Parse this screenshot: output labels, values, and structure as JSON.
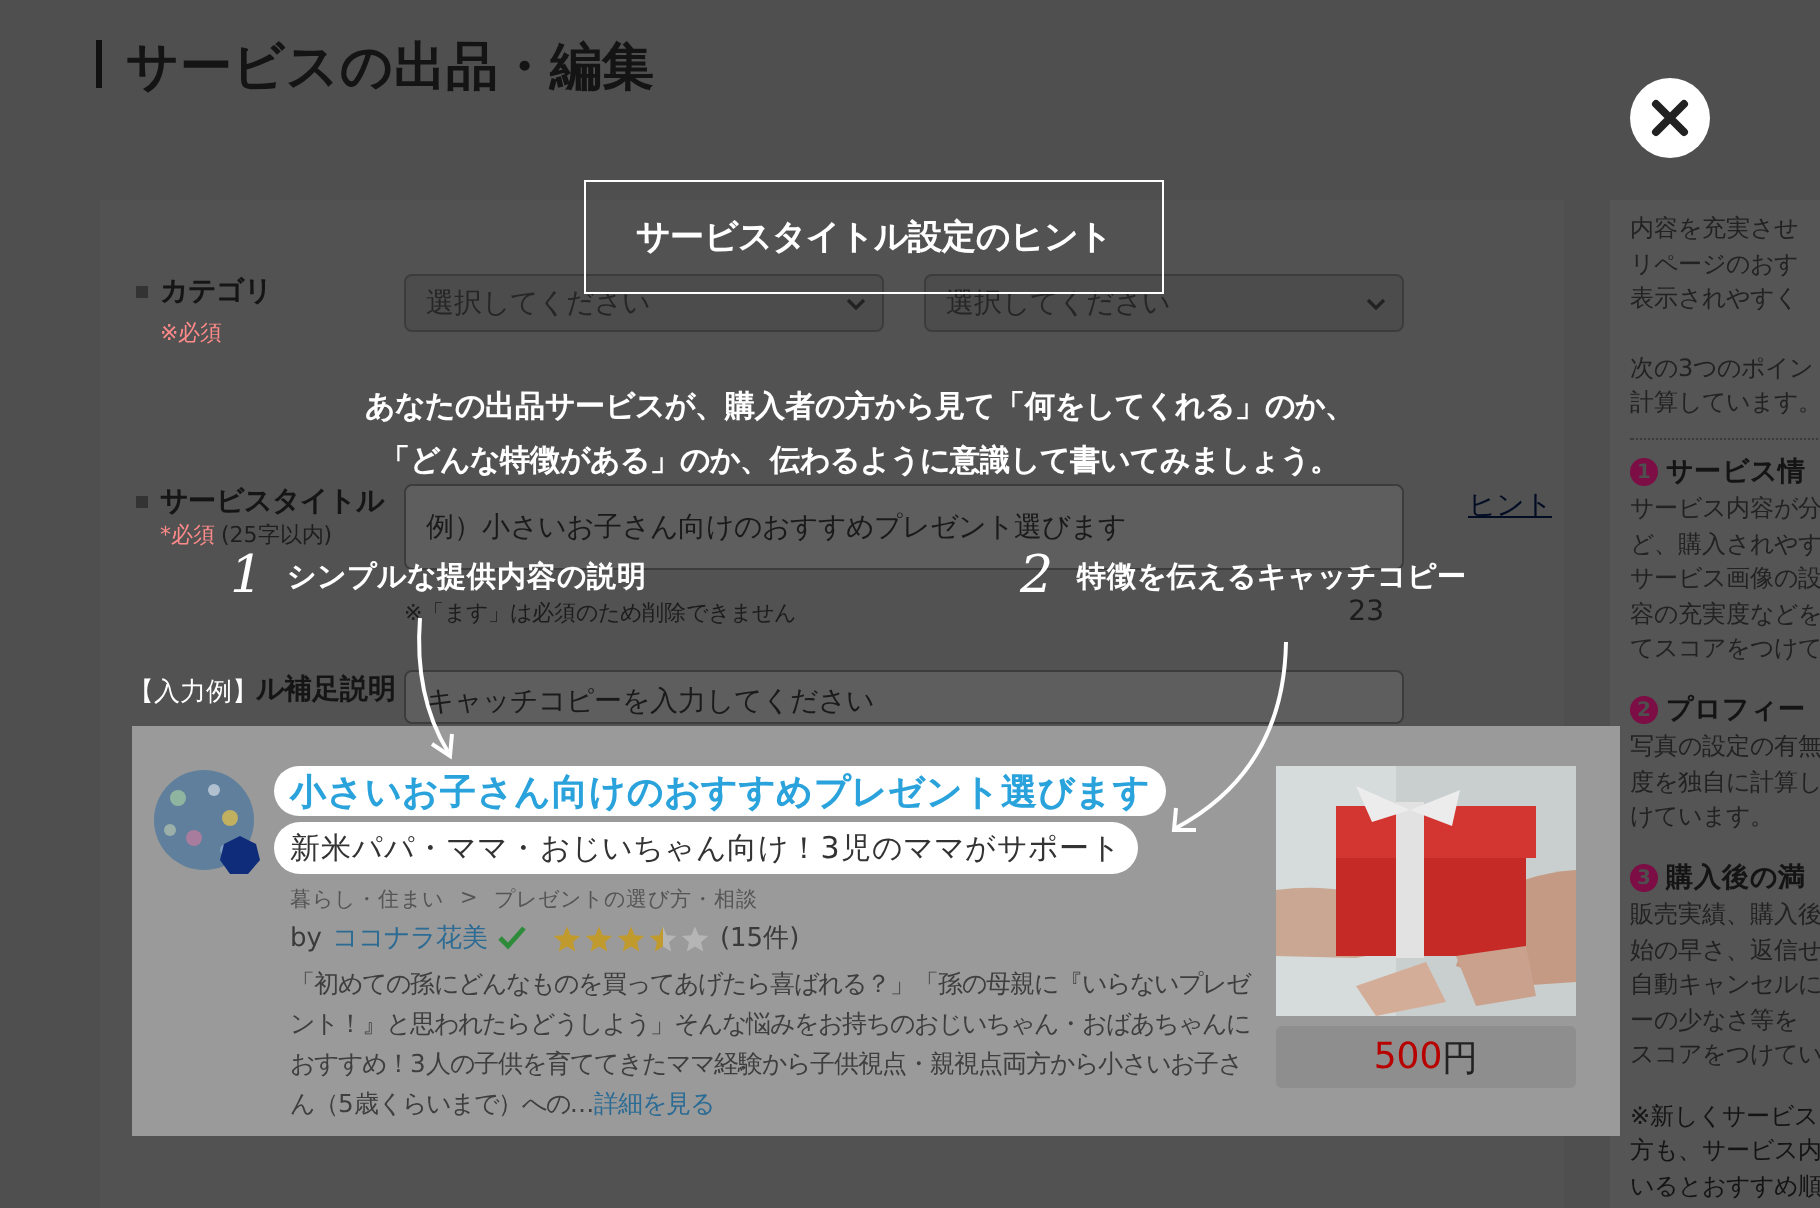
{
  "header": {
    "title": "サービスの出品・編集"
  },
  "form": {
    "rows": [
      {
        "kind": "select",
        "label": "カテゴリ",
        "required": "※必須",
        "selects": [
          "選択してください",
          "選択してください"
        ]
      },
      {
        "kind": "title",
        "label": "サービスタイトル",
        "required": "*必須",
        "limit": "(25字以内)",
        "placeholder": "例）小さいお子さん向けのおすすめプレゼント選びます",
        "hint_link": "ヒント",
        "note": "※「ます」は必須のため削除できません",
        "count": "23"
      },
      {
        "kind": "catch",
        "label": "ル補足説明",
        "placeholder": "キャッチコピーを入力してください"
      }
    ]
  },
  "sidebar": {
    "intro": [
      "内容を充実させ",
      "リページのおす",
      "表示されやすく"
    ],
    "intro_2": [
      "次の3つのポイン",
      "計算しています。"
    ],
    "sections": [
      {
        "number": "1",
        "title": "サービス情",
        "lines": [
          "サービス内容が分",
          "ど、購入されやす",
          "サービス画像の設",
          "容の充実度などを",
          "てスコアをつけて"
        ]
      },
      {
        "number": "2",
        "title": "プロフィー",
        "lines": [
          "写真の設定の有無",
          "度を独自に計算し",
          "けています。"
        ]
      },
      {
        "number": "3",
        "title": "購入後の満",
        "lines": [
          "販売実績、購入後",
          "始の早さ、返信せ",
          "自動キャンセルに",
          "ーの少なさ等を",
          "スコアをつけてい"
        ]
      }
    ],
    "footnote": [
      "※新しくサービス",
      "方も、サービス内",
      "いるとおすすめ順"
    ]
  },
  "hint_modal": {
    "title": "サービスタイトル設定のヒント",
    "lead": [
      "あなたの出品サービスが、購入者の方から見て「何をしてくれる」のか、",
      "「どんな特徴がある」のか、伝わるように意識して書いてみましょう。"
    ],
    "callouts": [
      {
        "number": "1",
        "text": "シンプルな提供内容の説明"
      },
      {
        "number": "2",
        "text": "特徴を伝えるキャッチコピー"
      }
    ],
    "example": {
      "label": "【入力例】",
      "title": "小さいお子さん向けのおすすめプレゼント選びます",
      "catch_copy": "新米パパ・ママ・おじいちゃん向け！3児のママがサポート",
      "breadcrumb": [
        "暮らし・住まい",
        "プレゼントの選び方・相談"
      ],
      "breadcrumb_separator": ">",
      "by": "by",
      "seller": "ココナラ花美",
      "verified": true,
      "stars": 3.5,
      "review_count": "(15件)",
      "description": "「初めての孫にどんなものを買ってあげたら喜ばれる？」「孫の母親に『いらないプレゼント！』と思われたらどうしよう」そんな悩みをお持ちのおじいちゃん・おばあちゃんにおすすめ！3人の子供を育ててきたママ経験から子供視点・親視点両方から小さいお子さん（5歳くらいまで）への…",
      "more_link": "詳細を見る",
      "price": "500",
      "currency": "円"
    }
  }
}
